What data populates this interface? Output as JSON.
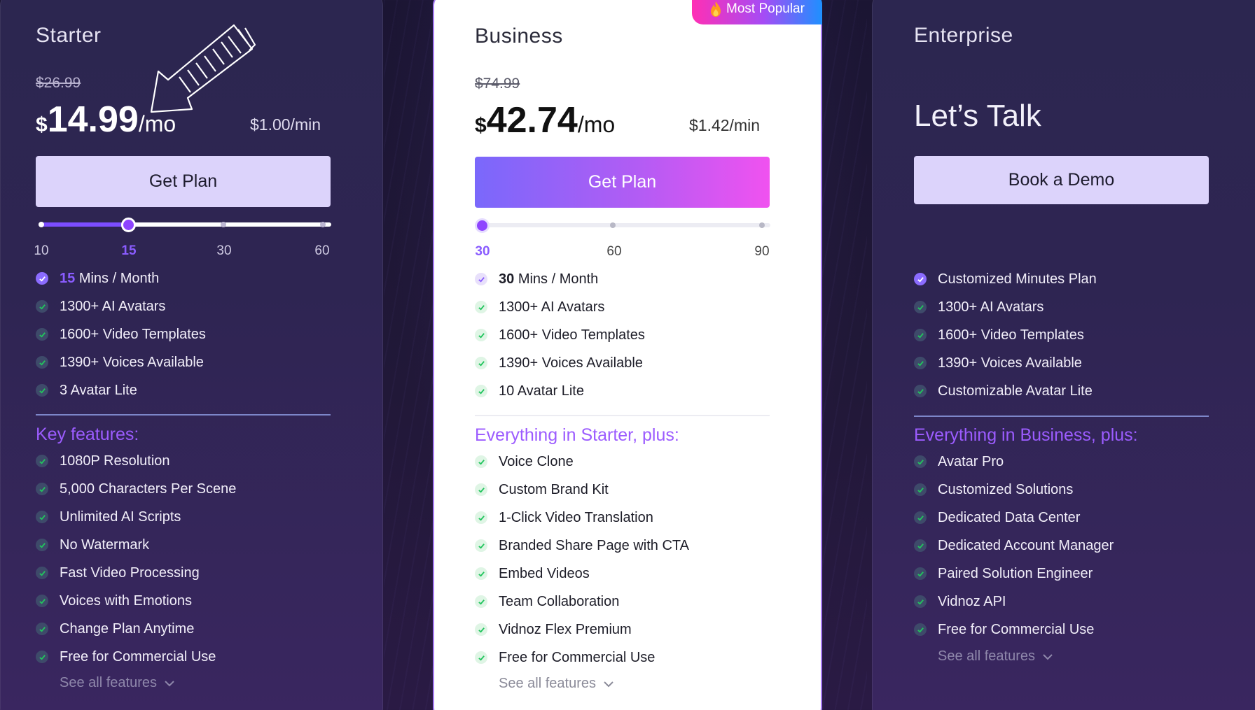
{
  "starter": {
    "name": "Starter",
    "old_price": "$26.99",
    "currency": "$",
    "amount": "14.99",
    "period": "/mo",
    "per_min": "$1.00/min",
    "button": "Get Plan",
    "slider": {
      "ticks": [
        "10",
        "15",
        "30",
        "60"
      ],
      "selected": "15"
    },
    "features": [
      {
        "value": "15",
        "text": "Mins / Month"
      },
      {
        "text": "1300+ AI Avatars"
      },
      {
        "text": "1600+ Video Templates"
      },
      {
        "text": "1390+ Voices Available"
      },
      {
        "text": "3 Avatar Lite"
      }
    ],
    "key_title": "Key features:",
    "key_features": [
      "1080P Resolution",
      "5,000 Characters Per Scene",
      "Unlimited AI Scripts",
      "No Watermark",
      "Fast Video Processing",
      "Voices with Emotions",
      "Change Plan Anytime",
      "Free for Commercial Use"
    ],
    "see_all": "See all features"
  },
  "business": {
    "badge": "Most Popular",
    "name": "Business",
    "old_price": "$74.99",
    "currency": "$",
    "amount": "42.74",
    "period": "/mo",
    "per_min": "$1.42/min",
    "button": "Get Plan",
    "slider": {
      "ticks": [
        "30",
        "60",
        "90"
      ],
      "selected": "30"
    },
    "features": [
      {
        "value": "30",
        "text": "Mins / Month"
      },
      {
        "text": "1300+ AI Avatars"
      },
      {
        "text": "1600+ Video Templates"
      },
      {
        "text": "1390+ Voices Available"
      },
      {
        "text": "10 Avatar Lite"
      }
    ],
    "key_title": "Everything in Starter, plus:",
    "key_features": [
      "Voice Clone",
      "Custom Brand Kit",
      "1-Click Video Translation",
      "Branded Share Page with CTA",
      "Embed Videos",
      "Team Collaboration",
      "Vidnoz Flex Premium",
      "Free for Commercial Use"
    ],
    "see_all": "See all features"
  },
  "enterprise": {
    "name": "Enterprise",
    "headline": "Let’s Talk",
    "button": "Book a Demo",
    "features": [
      "Customized Minutes Plan",
      "1300+ AI Avatars",
      "1600+ Video Templates",
      "1390+ Voices Available",
      "Customizable Avatar Lite"
    ],
    "key_title": "Everything in Business, plus:",
    "key_features": [
      "Avatar Pro",
      "Customized Solutions",
      "Dedicated Data Center",
      "Dedicated Account Manager",
      "Paired Solution Engineer",
      "Vidnoz API",
      "Free for Commercial Use"
    ],
    "see_all": "See all features"
  },
  "colors": {
    "accent_purple": "#8a5cff",
    "section_title": "#9c5cff",
    "button_pale": "#dcd3fb",
    "button_gradient_start": "#7a68fb",
    "button_gradient_end": "#f052f0",
    "check_green": "#22c55e",
    "page_bg": "#1b1533"
  },
  "icons": {
    "check": "check-icon",
    "chevron": "chevron-down-icon",
    "flame": "flame-icon",
    "arrow": "hand-drawn-arrow-icon"
  }
}
